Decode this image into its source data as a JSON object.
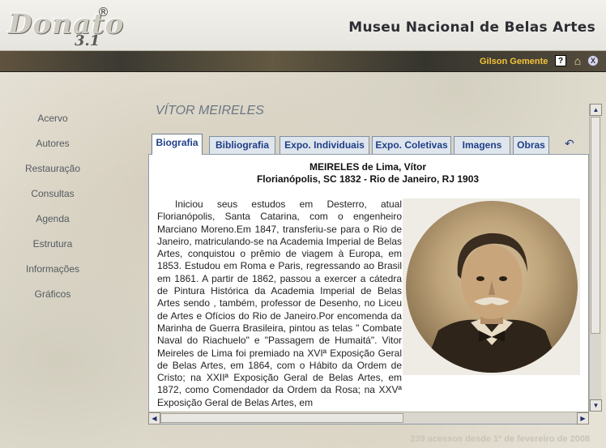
{
  "header": {
    "logo_text": "Donato",
    "logo_version": "3.1",
    "logo_reg": "®",
    "museum_title": "Museu Nacional de Belas Artes",
    "user_name": "Gilson Gemente",
    "help_icon": "?",
    "home_icon": "⌂",
    "close_icon": "X"
  },
  "nav": {
    "items": [
      "Acervo",
      "Autores",
      "Restauração",
      "Consultas",
      "Agenda",
      "Estrutura",
      "Informações",
      "Gráficos"
    ]
  },
  "artist": {
    "title": "VÍTOR MEIRELES"
  },
  "tabs": [
    "Biografia",
    "Bibliografia",
    "Expo. Individuais",
    "Expo. Coletivas",
    "Imagens",
    "Obras"
  ],
  "refresh_icon": "↶",
  "bio": {
    "name_line": "MEIRELES de Lima, Vítor",
    "origin_line": "Florianópolis, SC 1832 - Rio de Janeiro, RJ 1903",
    "text": "Iniciou seus estudos em Desterro, atual Florianópolis, Santa Catarina, com o engenheiro Marciano Moreno.Em 1847, transferiu-se para o Rio de Janeiro, matriculando-se na Academia Imperial de Belas Artes, conquistou o prêmio de viagem à Europa, em 1853. Estudou em Roma e Paris, regressando ao Brasil em 1861. A partir de 1862, passou a exercer a cátedra de Pintura Histórica da Academia Imperial de Belas Artes sendo , também, professor de Desenho, no Liceu de Artes e Ofícios do Rio de Janeiro.Por encomenda da Marinha de Guerra Brasileira, pintou as telas \" Combate Naval do Riachuelo\" e \"Passagem de Humaitá\". Vitor Meireles de Lima foi premiado na XVIª Exposição Geral de Belas Artes, em 1864, com o Hábito da Ordem de Cristo; na XXIIª Exposição Geral de Belas Artes, em 1872, como Comendador da Ordem da Rosa; na XXVª Exposição Geral de Belas Artes, em"
  },
  "footer": {
    "text": "239 acessos desde 1º de fevereiro de 2008"
  }
}
